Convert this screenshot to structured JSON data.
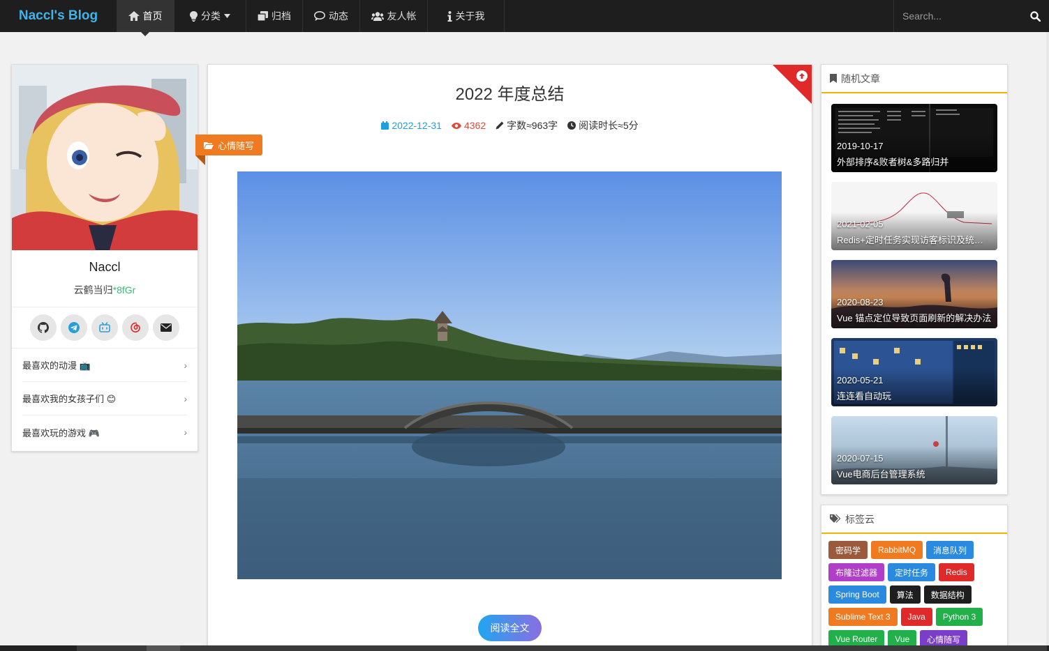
{
  "nav": {
    "brand": "Naccl's Blog",
    "items": [
      {
        "label": "首页",
        "icon": "home-icon"
      },
      {
        "label": "分类",
        "icon": "lightbulb-icon"
      },
      {
        "label": "归档",
        "icon": "archive-icon"
      },
      {
        "label": "动态",
        "icon": "chat-icon"
      },
      {
        "label": "友人帐",
        "icon": "users-icon"
      },
      {
        "label": "关于我",
        "icon": "info-icon"
      }
    ],
    "search_placeholder": "Search..."
  },
  "profile": {
    "name": "Naccl",
    "motto_prefix": "云鹤当归",
    "motto_code": "*8fGr",
    "socials": [
      "github-icon",
      "telegram-icon",
      "bilibili-icon",
      "netease-music-icon",
      "email-icon"
    ],
    "favorites": [
      {
        "label": "最喜欢的动漫 📺"
      },
      {
        "label": "最喜欢我的女孩子们 😊"
      },
      {
        "label": "最喜欢玩的游戏 🎮"
      }
    ]
  },
  "article": {
    "title": "2022 年度总结",
    "date": "2022-12-31",
    "views": "4362",
    "words": "字数≈963字",
    "read_time": "阅读时长≈5分",
    "category": "心情随写",
    "read_more": "阅读全文"
  },
  "random": {
    "heading": "随机文章",
    "posts": [
      {
        "date": "2019-10-17",
        "title": "外部排序&败者树&多路归并"
      },
      {
        "date": "2021-02-05",
        "title": "Redis+定时任务实现访客标识及统计PV..."
      },
      {
        "date": "2020-08-23",
        "title": "Vue 锚点定位导致页面刷新的解决办法"
      },
      {
        "date": "2020-05-21",
        "title": "连连看自动玩"
      },
      {
        "date": "2020-07-15",
        "title": "Vue电商后台管理系统"
      }
    ]
  },
  "tag_cloud": {
    "heading": "标签云",
    "tags": [
      {
        "label": "密码学",
        "color": "#9b5a3c"
      },
      {
        "label": "RabbitMQ",
        "color": "#f07a20"
      },
      {
        "label": "消息队列",
        "color": "#2a8ae0"
      },
      {
        "label": "布隆过滤器",
        "color": "#b03ec8"
      },
      {
        "label": "定时任务",
        "color": "#2a8ae0"
      },
      {
        "label": "Redis",
        "color": "#e02a2a"
      },
      {
        "label": "Spring Boot",
        "color": "#2a8ae0"
      },
      {
        "label": "算法",
        "color": "#1e1e1e"
      },
      {
        "label": "数据结构",
        "color": "#1e1e1e"
      },
      {
        "label": "Sublime Text 3",
        "color": "#f07a20"
      },
      {
        "label": "Java",
        "color": "#e02a2a"
      },
      {
        "label": "Python 3",
        "color": "#22b04a"
      },
      {
        "label": "Vue Router",
        "color": "#22b04a"
      },
      {
        "label": "Vue",
        "color": "#22b04a"
      },
      {
        "label": "心情随写",
        "color": "#7a3ec8"
      }
    ]
  }
}
